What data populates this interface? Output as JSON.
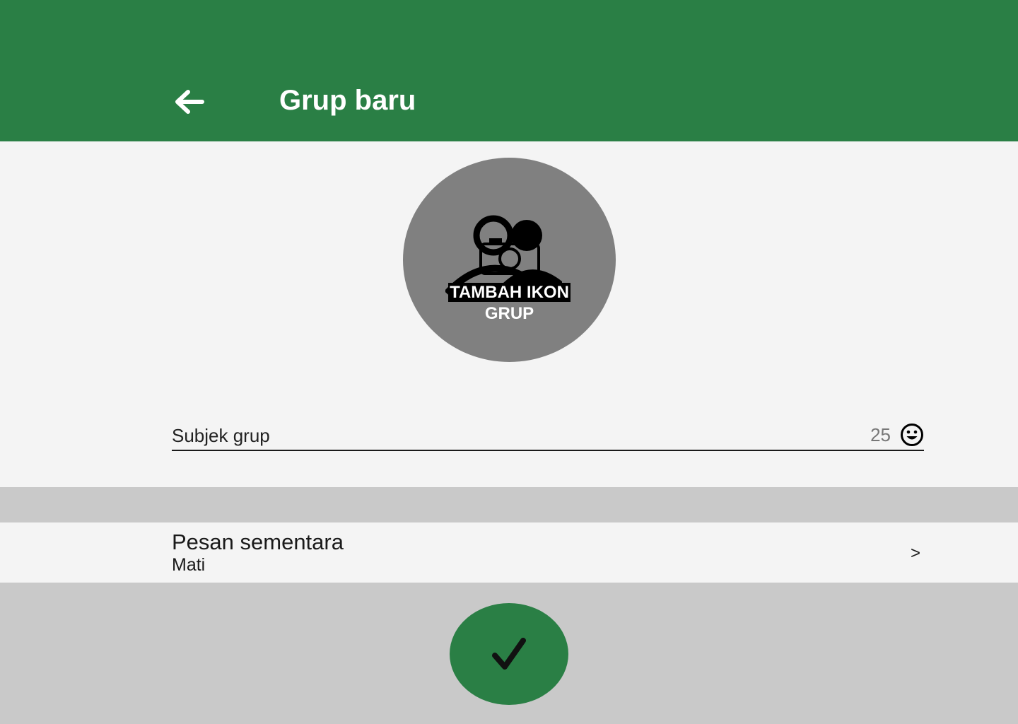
{
  "header": {
    "title": "Grup baru",
    "back_icon": "arrow-left-icon",
    "background": "#2a7f45"
  },
  "group_icon": {
    "label_line1": "TAMBAH IKON",
    "label_line2": "GRUP",
    "icon": "camera-people-icon",
    "background": "#808080"
  },
  "subject": {
    "placeholder": "Subjek grup",
    "value": "",
    "char_remaining": "25",
    "emoji_icon": "smiley-icon"
  },
  "settings": {
    "disappearing_messages": {
      "title": "Pesan sementara",
      "value": "Mati",
      "chevron": ">"
    }
  },
  "confirm": {
    "icon": "checkmark-icon",
    "background": "#2a7f45"
  }
}
